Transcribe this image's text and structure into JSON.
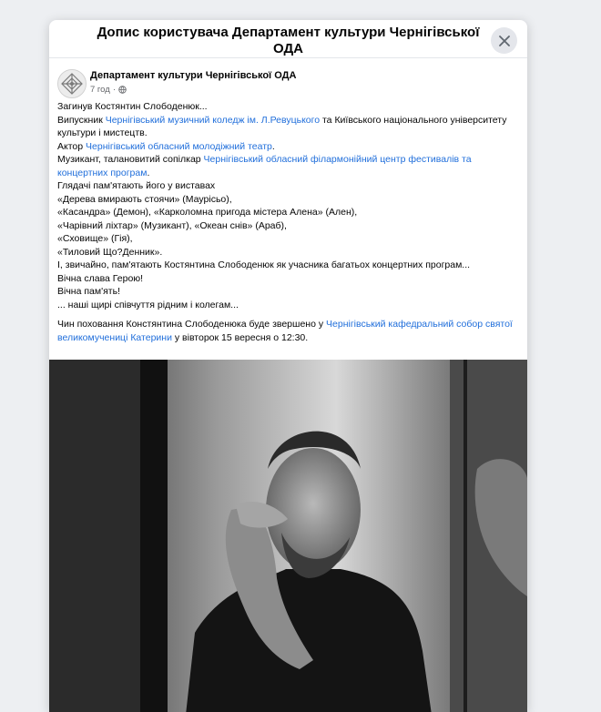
{
  "dialog": {
    "title": "Допис користувача Департамент культури Чернігівської ОДА",
    "close_icon": "close-icon"
  },
  "post": {
    "author": "Департамент культури Чернігівської ОДА",
    "time": "7 год",
    "separator": "·",
    "privacy_icon": "globe-icon",
    "lines": {
      "l1": "Загинув Костянтин Слободенюк...",
      "l2_pre": "Випускник ",
      "l2_link": "Чернігівський музичний коледж ім. Л.Ревуцького",
      "l2_post": " та Київського національного університету культури і мистецтв.",
      "l3_pre": "Актор ",
      "l3_link": "Чернігівський обласний молодіжний театр",
      "l3_post": ".",
      "l4_pre": "Музикант, талановитий сопілкар ",
      "l4_link": "Чернігівський обласний філармонійний центр фестивалів та концертних програм",
      "l4_post": ".",
      "l5": "Глядачі пам'ятають його у виставах",
      "l6": "«Дерева вмирають стоячи» (Маурісьо),",
      "l7": "«Касандра» (Демон), «Карколомна пригода містера Алена» (Ален),",
      "l8": "«Чарівний ліхтар» (Музикант), «Океан снів» (Араб),",
      "l9": "«Сховище» (Гія),",
      "l10": " «Тиловий Що?Денник».",
      "l11": " І, звичайно, пам'ятають Костянтина Слободенюк як учасника багатьох концертних програм...",
      "l12": "Вічна слава Герою!",
      "l13": "Вічна пам'ять!",
      "l14": "... наші щирі співчуття рідним і колегам...",
      "l15_pre": "Чин поховання Констянтина Слободенюка буде звершено у ",
      "l15_link": "Чернігівський кафедральний собор святої великомучениці Катерини",
      "l15_post": " у вівторок  15 вересня о 12:30."
    },
    "photo_description_icon": "photo"
  }
}
